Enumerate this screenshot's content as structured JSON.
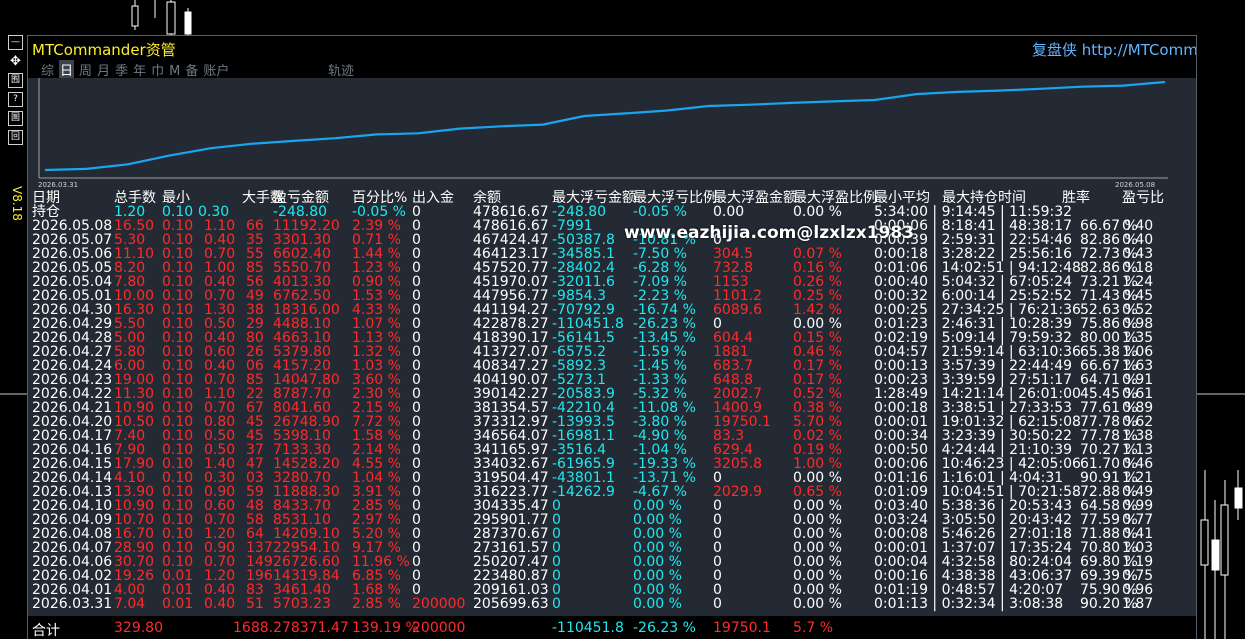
{
  "app": {
    "title": "MTCommander资管",
    "brand": "复盘侠 http://MTCommander.com",
    "version": "V8.18"
  },
  "side_toolbar": [
    {
      "name": "minimize-icon",
      "glyph": "—"
    },
    {
      "name": "move-icon",
      "glyph": "✥"
    },
    {
      "name": "report-icon",
      "glyph": "囿"
    },
    {
      "name": "help-icon",
      "glyph": "?"
    },
    {
      "name": "grid-icon",
      "glyph": "圄"
    },
    {
      "name": "window-icon",
      "glyph": "回"
    }
  ],
  "tabs": [
    {
      "label": "综",
      "active": false
    },
    {
      "label": "日",
      "active": true
    },
    {
      "label": "周",
      "active": false
    },
    {
      "label": "月",
      "active": false
    },
    {
      "label": "季",
      "active": false
    },
    {
      "label": "年",
      "active": false
    },
    {
      "label": "巾",
      "active": false
    },
    {
      "label": "M",
      "active": false
    },
    {
      "label": "备",
      "active": false
    },
    {
      "label": "账户",
      "active": false
    }
  ],
  "track_tab": "轨迹",
  "equity_chart": {
    "start_date": "2026.03.31",
    "end_date": "2026.05.08",
    "line_color": "#1aa6ef",
    "values": [
      205699.63,
      209161.03,
      223480.87,
      250207.47,
      273161.57,
      287370.67,
      295901.77,
      304335.47,
      316223.77,
      319504.47,
      334032.67,
      341165.97,
      346564.07,
      373312.97,
      381354.57,
      390142.27,
      404190.07,
      408347.27,
      413727.07,
      418390.17,
      422878.27,
      441194.27,
      447956.77,
      451970.07,
      457520.77,
      464123.17,
      467424.47,
      478616.67
    ]
  },
  "watermark": "www.eazhijia.com@lzxlzx1983",
  "columns": [
    "日期",
    "总手数",
    "最小",
    "大手数",
    "盈亏金额",
    "百分比%",
    "出入金",
    "余额",
    "最大浮亏金额",
    "最大浮亏比例",
    "最大浮盈金额",
    "最大浮盈比例",
    "最小平均",
    "最大持仓时间",
    "胜率",
    "盈亏比"
  ],
  "holding": {
    "label": "持仓",
    "lots": "1.20",
    "min": "0.10",
    "max": "0.30",
    "pnl": "-248.80",
    "pct": "-0.05 %",
    "flow": "0",
    "balance": "478616.67",
    "float_loss": "-248.80",
    "float_loss_pct": "-0.05 %",
    "float_gain": "0.00",
    "float_gain_pct": "0.00 %",
    "hold_times": "5:34:00 | 9:14:45 | 11:59:32"
  },
  "rows": [
    {
      "date": "2026.05.08",
      "lots": "16.50",
      "min": "0.10",
      "max": "1.10",
      "cnt": "66",
      "pnl": "11192.20",
      "pct": "2.39 %",
      "flow": "0",
      "balance": "478616.67",
      "fl": "-7991",
      "flp": "",
      "fg": "",
      "fgp": "",
      "times": "0:00:06 | 8:18:41 | 48:38:17",
      "win": "66.67 %",
      "ratio": "0.40"
    },
    {
      "date": "2026.05.07",
      "lots": "5.30",
      "min": "0.10",
      "max": "0.40",
      "cnt": "35",
      "pnl": "3301.30",
      "pct": "0.71 %",
      "flow": "0",
      "balance": "467424.47",
      "fl": "-50387.8",
      "flp": "-10.81 %",
      "fg": "0",
      "fgp": "",
      "times": "0:00:39 | 2:59:31 | 22:54:46",
      "win": "82.86 %",
      "ratio": "0.40"
    },
    {
      "date": "2026.05.06",
      "lots": "11.10",
      "min": "0.10",
      "max": "0.70",
      "cnt": "55",
      "pnl": "6602.40",
      "pct": "1.44 %",
      "flow": "0",
      "balance": "464123.17",
      "fl": "-34585.1",
      "flp": "-7.50 %",
      "fg": "304.5",
      "fgp": "0.07 %",
      "times": "0:00:18 | 3:28:22 | 25:56:16",
      "win": "72.73 %",
      "ratio": "0.43"
    },
    {
      "date": "2026.05.05",
      "lots": "8.20",
      "min": "0.10",
      "max": "1.00",
      "cnt": "85",
      "pnl": "5550.70",
      "pct": "1.23 %",
      "flow": "0",
      "balance": "457520.77",
      "fl": "-28402.4",
      "flp": "-6.28 %",
      "fg": "732.8",
      "fgp": "0.16 %",
      "times": "0:01:06 | 14:02:51 | 94:12:48",
      "win": "82.86 %",
      "ratio": "0.18"
    },
    {
      "date": "2026.05.04",
      "lots": "7.80",
      "min": "0.10",
      "max": "0.40",
      "cnt": "56",
      "pnl": "4013.30",
      "pct": "0.90 %",
      "flow": "0",
      "balance": "451970.07",
      "fl": "-32011.6",
      "flp": "-7.09 %",
      "fg": "1153",
      "fgp": "0.26 %",
      "times": "0:00:40 | 5:04:32 | 67:05:24",
      "win": "73.21 %",
      "ratio": "1.24"
    },
    {
      "date": "2026.05.01",
      "lots": "10.00",
      "min": "0.10",
      "max": "0.70",
      "cnt": "49",
      "pnl": "6762.50",
      "pct": "1.53 %",
      "flow": "0",
      "balance": "447956.77",
      "fl": "-9854.3",
      "flp": "-2.23 %",
      "fg": "1101.2",
      "fgp": "0.25 %",
      "times": "0:00:32 | 6:00:14 | 25:52:52",
      "win": "71.43 %",
      "ratio": "0.45"
    },
    {
      "date": "2026.04.30",
      "lots": "16.30",
      "min": "0.10",
      "max": "1.30",
      "cnt": "38",
      "pnl": "18316.00",
      "pct": "4.33 %",
      "flow": "0",
      "balance": "441194.27",
      "fl": "-70792.9",
      "flp": "-16.74 %",
      "fg": "6089.6",
      "fgp": "1.42 %",
      "times": "0:00:25 | 27:34:25 | 76:21:36",
      "win": "52.63 %",
      "ratio": "0.52"
    },
    {
      "date": "2026.04.29",
      "lots": "5.50",
      "min": "0.10",
      "max": "0.50",
      "cnt": "29",
      "pnl": "4488.10",
      "pct": "1.07 %",
      "flow": "0",
      "balance": "422878.27",
      "fl": "-110451.8",
      "flp": "-26.23 %",
      "fg": "0",
      "fgp": "0.00 %",
      "times": "0:01:23 | 2:46:31 | 10:28:39",
      "win": "75.86 %",
      "ratio": "0.98"
    },
    {
      "date": "2026.04.28",
      "lots": "5.00",
      "min": "0.10",
      "max": "0.40",
      "cnt": "80",
      "pnl": "4663.10",
      "pct": "1.13 %",
      "flow": "0",
      "balance": "418390.17",
      "fl": "-56141.5",
      "flp": "-13.45 %",
      "fg": "604.4",
      "fgp": "0.15 %",
      "times": "0:02:19 | 5:09:14 | 79:59:32",
      "win": "80.00 %",
      "ratio": "1.35"
    },
    {
      "date": "2026.04.27",
      "lots": "5.80",
      "min": "0.10",
      "max": "0.60",
      "cnt": "26",
      "pnl": "5379.80",
      "pct": "1.32 %",
      "flow": "0",
      "balance": "413727.07",
      "fl": "-6575.2",
      "flp": "-1.59 %",
      "fg": "1881",
      "fgp": "0.46 %",
      "times": "0:04:57 | 21:59:14 | 63:10:36",
      "win": "65.38 %",
      "ratio": "1.06"
    },
    {
      "date": "2026.04.24",
      "lots": "6.00",
      "min": "0.10",
      "max": "0.40",
      "cnt": "06",
      "pnl": "4157.20",
      "pct": "1.03 %",
      "flow": "0",
      "balance": "408347.27",
      "fl": "-5892.3",
      "flp": "-1.45 %",
      "fg": "683.7",
      "fgp": "0.17 %",
      "times": "0:00:13 | 3:57:39 | 22:44:49",
      "win": "66.67 %",
      "ratio": "1.63"
    },
    {
      "date": "2026.04.23",
      "lots": "19.00",
      "min": "0.10",
      "max": "0.70",
      "cnt": "85",
      "pnl": "14047.80",
      "pct": "3.60 %",
      "flow": "0",
      "balance": "404190.07",
      "fl": "-5273.1",
      "flp": "-1.33 %",
      "fg": "648.8",
      "fgp": "0.17 %",
      "times": "0:00:23 | 3:39:59 | 27:51:17",
      "win": "64.71 %",
      "ratio": "0.91"
    },
    {
      "date": "2026.04.22",
      "lots": "11.30",
      "min": "0.10",
      "max": "1.10",
      "cnt": "22",
      "pnl": "8787.70",
      "pct": "2.30 %",
      "flow": "0",
      "balance": "390142.27",
      "fl": "-20583.9",
      "flp": "-5.32 %",
      "fg": "2002.7",
      "fgp": "0.52 %",
      "times": "1:28:49 | 14:21:14 | 26:01:00",
      "win": "45.45 %",
      "ratio": "0.61"
    },
    {
      "date": "2026.04.21",
      "lots": "10.90",
      "min": "0.10",
      "max": "0.70",
      "cnt": "67",
      "pnl": "8041.60",
      "pct": "2.15 %",
      "flow": "0",
      "balance": "381354.57",
      "fl": "-42210.4",
      "flp": "-11.08 %",
      "fg": "1400.9",
      "fgp": "0.38 %",
      "times": "0:00:18 | 3:38:51 | 27:33:53",
      "win": "77.61 %",
      "ratio": "0.89"
    },
    {
      "date": "2026.04.20",
      "lots": "10.50",
      "min": "0.10",
      "max": "0.80",
      "cnt": "45",
      "pnl": "26748.90",
      "pct": "7.72 %",
      "flow": "0",
      "balance": "373312.97",
      "fl": "-13993.5",
      "flp": "-3.80 %",
      "fg": "19750.1",
      "fgp": "5.70 %",
      "times": "0:00:01 | 19:01:32 | 62:15:08",
      "win": "77.78 %",
      "ratio": "0.62"
    },
    {
      "date": "2026.04.17",
      "lots": "7.40",
      "min": "0.10",
      "max": "0.50",
      "cnt": "45",
      "pnl": "5398.10",
      "pct": "1.58 %",
      "flow": "0",
      "balance": "346564.07",
      "fl": "-16981.1",
      "flp": "-4.90 %",
      "fg": "83.3",
      "fgp": "0.02 %",
      "times": "0:00:34 | 3:23:39 | 30:50:22",
      "win": "77.78 %",
      "ratio": "1.38"
    },
    {
      "date": "2026.04.16",
      "lots": "7.90",
      "min": "0.10",
      "max": "0.50",
      "cnt": "37",
      "pnl": "7133.30",
      "pct": "2.14 %",
      "flow": "0",
      "balance": "341165.97",
      "fl": "-3516.4",
      "flp": "-1.04 %",
      "fg": "629.4",
      "fgp": "0.19 %",
      "times": "0:00:50 | 4:24:44 | 21:10:39",
      "win": "70.27 %",
      "ratio": "1.13"
    },
    {
      "date": "2026.04.15",
      "lots": "17.90",
      "min": "0.10",
      "max": "1.40",
      "cnt": "47",
      "pnl": "14528.20",
      "pct": "4.55 %",
      "flow": "0",
      "balance": "334032.67",
      "fl": "-61965.9",
      "flp": "-19.33 %",
      "fg": "3205.8",
      "fgp": "1.00 %",
      "times": "0:00:06 | 10:46:23 | 42:05:06",
      "win": "61.70 %",
      "ratio": "0.46"
    },
    {
      "date": "2026.04.14",
      "lots": "4.10",
      "min": "0.10",
      "max": "0.30",
      "cnt": "03",
      "pnl": "3280.70",
      "pct": "1.04 %",
      "flow": "0",
      "balance": "319504.47",
      "fl": "-43801.1",
      "flp": "-13.71 %",
      "fg": "0",
      "fgp": "0.00 %",
      "times": "0:01:16 | 1:16:01 | 4:04:31",
      "win": "90.91 %",
      "ratio": "1.21"
    },
    {
      "date": "2026.04.13",
      "lots": "13.90",
      "min": "0.10",
      "max": "0.90",
      "cnt": "59",
      "pnl": "11888.30",
      "pct": "3.91 %",
      "flow": "0",
      "balance": "316223.77",
      "fl": "-14262.9",
      "flp": "-4.67 %",
      "fg": "2029.9",
      "fgp": "0.65 %",
      "times": "0:01:09 | 10:04:51 | 70:21:58",
      "win": "72.88 %",
      "ratio": "0.49"
    },
    {
      "date": "2026.04.10",
      "lots": "10.90",
      "min": "0.10",
      "max": "0.60",
      "cnt": "48",
      "pnl": "8433.70",
      "pct": "2.85 %",
      "flow": "0",
      "balance": "304335.47",
      "fl": "0",
      "flp": "0.00 %",
      "fg": "0",
      "fgp": "0.00 %",
      "times": "0:03:40 | 5:38:36 | 20:53:43",
      "win": "64.58 %",
      "ratio": "0.99"
    },
    {
      "date": "2026.04.09",
      "lots": "10.70",
      "min": "0.10",
      "max": "0.70",
      "cnt": "58",
      "pnl": "8531.10",
      "pct": "2.97 %",
      "flow": "0",
      "balance": "295901.77",
      "fl": "0",
      "flp": "0.00 %",
      "fg": "0",
      "fgp": "0.00 %",
      "times": "0:03:24 | 3:05:50 | 20:43:42",
      "win": "77.59 %",
      "ratio": "0.77"
    },
    {
      "date": "2026.04.08",
      "lots": "16.70",
      "min": "0.10",
      "max": "1.20",
      "cnt": "64",
      "pnl": "14209.10",
      "pct": "5.20 %",
      "flow": "0",
      "balance": "287370.67",
      "fl": "0",
      "flp": "0.00 %",
      "fg": "0",
      "fgp": "0.00 %",
      "times": "0:00:08 | 5:46:26 | 27:01:18",
      "win": "71.88 %",
      "ratio": "0.41"
    },
    {
      "date": "2026.04.07",
      "lots": "28.90",
      "min": "0.10",
      "max": "0.90",
      "cnt": "137",
      "pnl": "22954.10",
      "pct": "9.17 %",
      "flow": "0",
      "balance": "273161.57",
      "fl": "0",
      "flp": "0.00 %",
      "fg": "0",
      "fgp": "0.00 %",
      "times": "0:00:01 | 1:37:07 | 17:35:24",
      "win": "70.80 %",
      "ratio": "1.03"
    },
    {
      "date": "2026.04.06",
      "lots": "30.70",
      "min": "0.10",
      "max": "0.70",
      "cnt": "149",
      "pnl": "26726.60",
      "pct": "11.96 %",
      "flow": "0",
      "balance": "250207.47",
      "fl": "0",
      "flp": "0.00 %",
      "fg": "0",
      "fgp": "0.00 %",
      "times": "0:00:04 | 4:32:58 | 80:24:04",
      "win": "69.80 %",
      "ratio": "1.19"
    },
    {
      "date": "2026.04.02",
      "lots": "19.26",
      "min": "0.01",
      "max": "1.20",
      "cnt": "196",
      "pnl": "14319.84",
      "pct": "6.85 %",
      "flow": "0",
      "balance": "223480.87",
      "fl": "0",
      "flp": "0.00 %",
      "fg": "0",
      "fgp": "0.00 %",
      "times": "0:00:16 | 4:38:38 | 43:06:37",
      "win": "69.39 %",
      "ratio": "0.75"
    },
    {
      "date": "2026.04.01",
      "lots": "4.00",
      "min": "0.01",
      "max": "0.40",
      "cnt": "83",
      "pnl": "3461.40",
      "pct": "1.68 %",
      "flow": "0",
      "balance": "209161.03",
      "fl": "0",
      "flp": "0.00 %",
      "fg": "0",
      "fgp": "0.00 %",
      "times": "0:01:19 | 0:48:57 | 4:20:07",
      "win": "75.90 %",
      "ratio": "0.96"
    },
    {
      "date": "2026.03.31",
      "lots": "7.04",
      "min": "0.01",
      "max": "0.40",
      "cnt": "51",
      "pnl": "5703.23",
      "pct": "2.85 %",
      "flow": "200000",
      "balance": "205699.63",
      "fl": "0",
      "flp": "0.00 %",
      "fg": "0",
      "fgp": "0.00 %",
      "times": "0:01:13 | 0:32:34 | 3:08:38",
      "win": "90.20 %",
      "ratio": "1.87"
    }
  ],
  "footer": {
    "label": "合计",
    "lots": "329.80",
    "trades_pnl": "1688.278371.47",
    "pct": "139.19 %",
    "flow": "200000",
    "float_loss": "-110451.8",
    "float_loss_pct": "-26.23 %",
    "float_gain": "19750.1",
    "float_gain_pct": "5.7 %"
  },
  "colors": {
    "profit": "#ff2a2a",
    "percent": "#20e8f0",
    "title": "#ffef2a",
    "brand": "#63b4ff",
    "equity": "#1aa6ef"
  }
}
